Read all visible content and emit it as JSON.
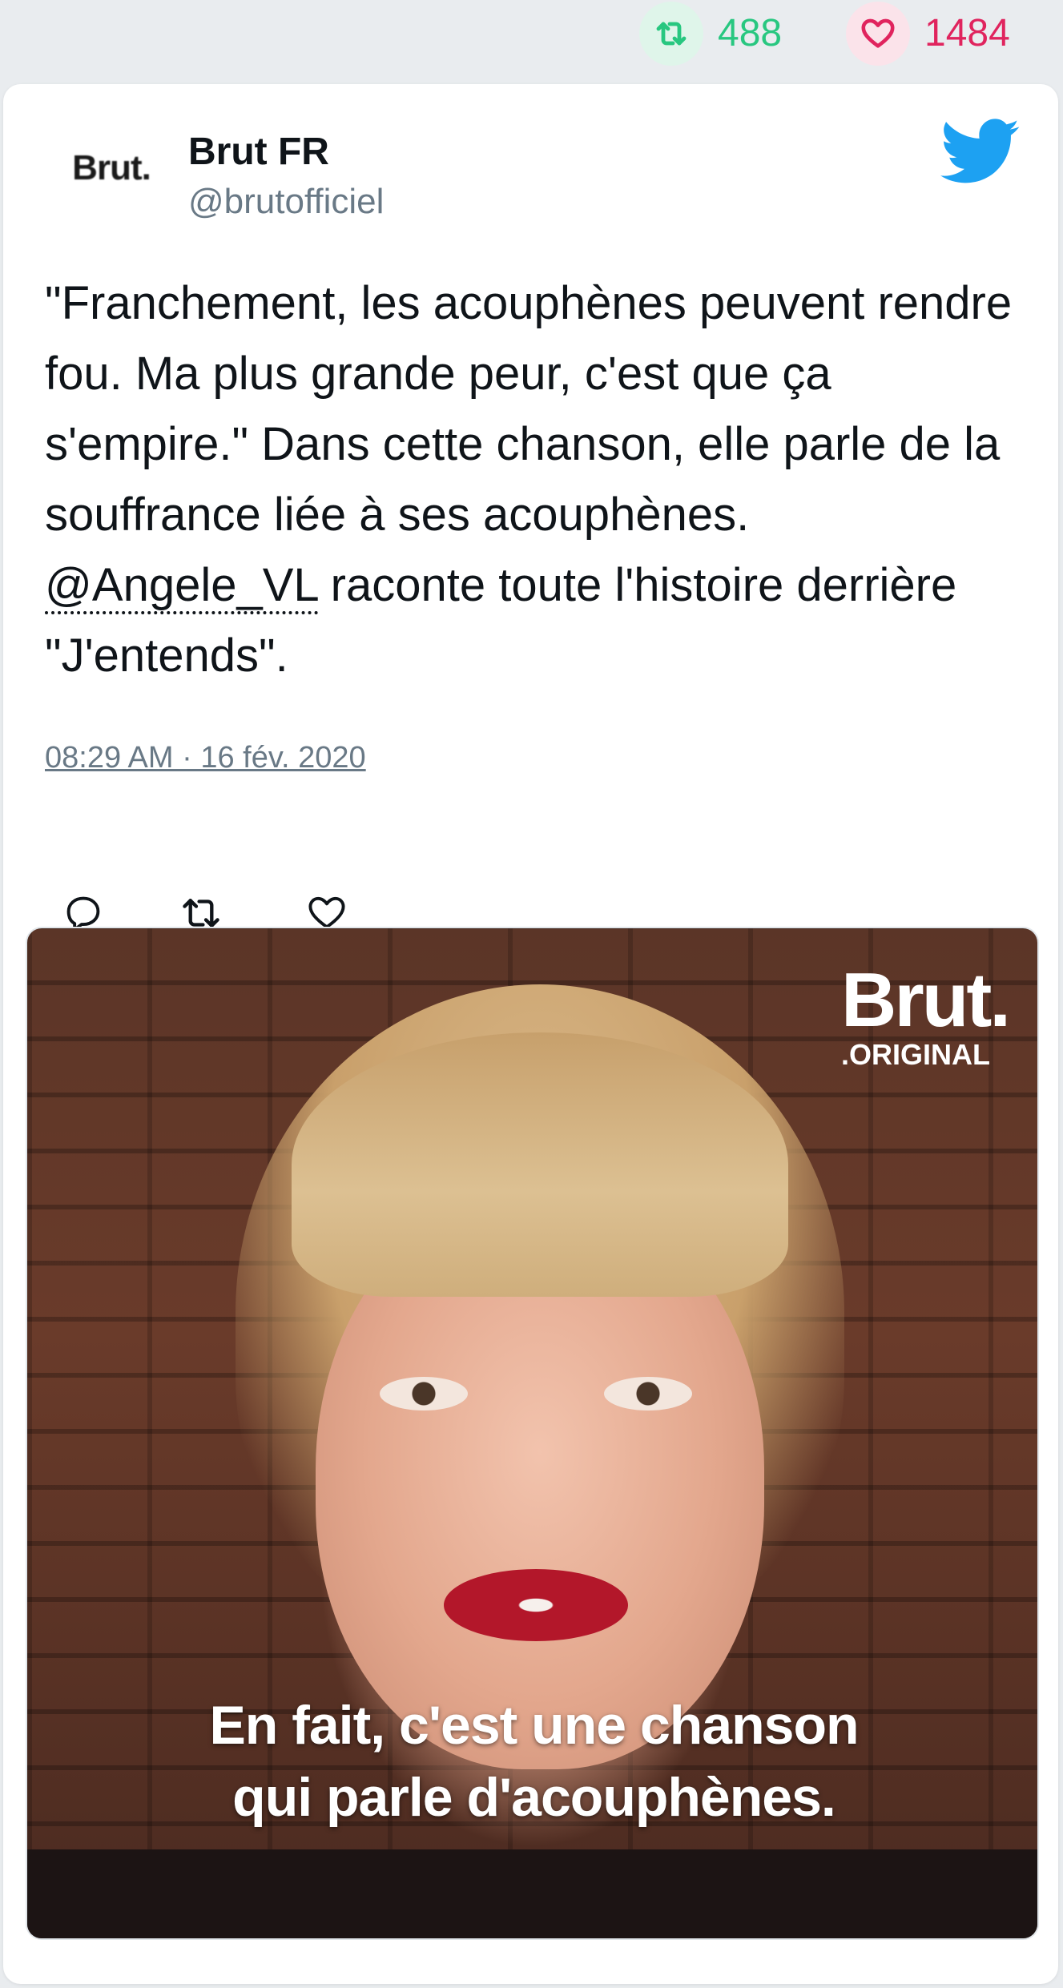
{
  "stats": {
    "retweets": "488",
    "likes": "1484"
  },
  "colors": {
    "retweet_green": "#28c780",
    "like_red": "#e0245e",
    "twitter_blue": "#1da1f2",
    "muted_gray": "#697986"
  },
  "tweet": {
    "avatar_text": "Brut.",
    "author_name": "Brut FR",
    "author_handle": "@brutofficiel",
    "text_before": "\"Franchement, les acouphènes peuvent rendre fou. Ma plus grande peur, c'est que ça s'empire.\" Dans cette chanson, elle parle de la souffrance liée à ses acouphènes. ",
    "mention": "@Angele_VL",
    "text_after": " raconte toute l'histoire derrière \"J'entends\".",
    "timestamp": "08:29 AM · 16 fév. 2020"
  },
  "icons": {
    "retweet": "retweet-icon",
    "like": "heart-icon",
    "reply": "reply-icon",
    "logo": "twitter-bird-icon"
  },
  "media": {
    "watermark_word": "Brut.",
    "watermark_sub": ".ORIGINAL",
    "caption_line1": "En fait, c'est une chanson",
    "caption_line2": "qui parle d'acouphènes."
  }
}
